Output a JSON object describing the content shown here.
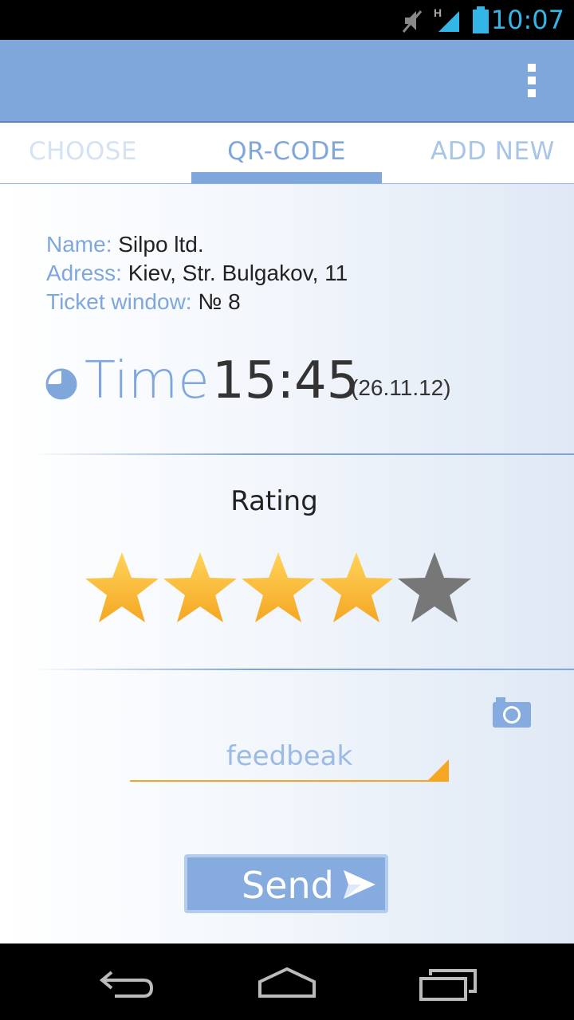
{
  "status_bar": {
    "time": "10:07",
    "network_type": "H",
    "icons": [
      "mute-icon",
      "signal-icon",
      "battery-icon"
    ],
    "accent_color": "#33b5e5"
  },
  "action_bar": {
    "color": "#7fa7dc",
    "menu_icon": "overflow-menu-icon"
  },
  "tabs": [
    {
      "label": "CHOOSE",
      "selected": false
    },
    {
      "label": "QR-CODE",
      "selected": true
    },
    {
      "label": "ADD NEW",
      "selected": false
    }
  ],
  "details": {
    "name_label": "Name:",
    "name_value": "Silpo ltd.",
    "address_label": "Adress:",
    "address_value": "Kiev, Str. Bulgakov, 11",
    "window_label": "Ticket window:",
    "window_value": "№ 8"
  },
  "time": {
    "label": "Time",
    "value": "15:45",
    "date": "(26.11.12)"
  },
  "rating": {
    "label": "Rating",
    "value": 4,
    "max": 5,
    "filled_color": "#f5a623",
    "empty_color": "#777777"
  },
  "feedback": {
    "placeholder": "feedbeak"
  },
  "send": {
    "label": "Send"
  },
  "nav_bar": {
    "icons": [
      "back-icon",
      "home-icon",
      "recent-apps-icon"
    ]
  }
}
